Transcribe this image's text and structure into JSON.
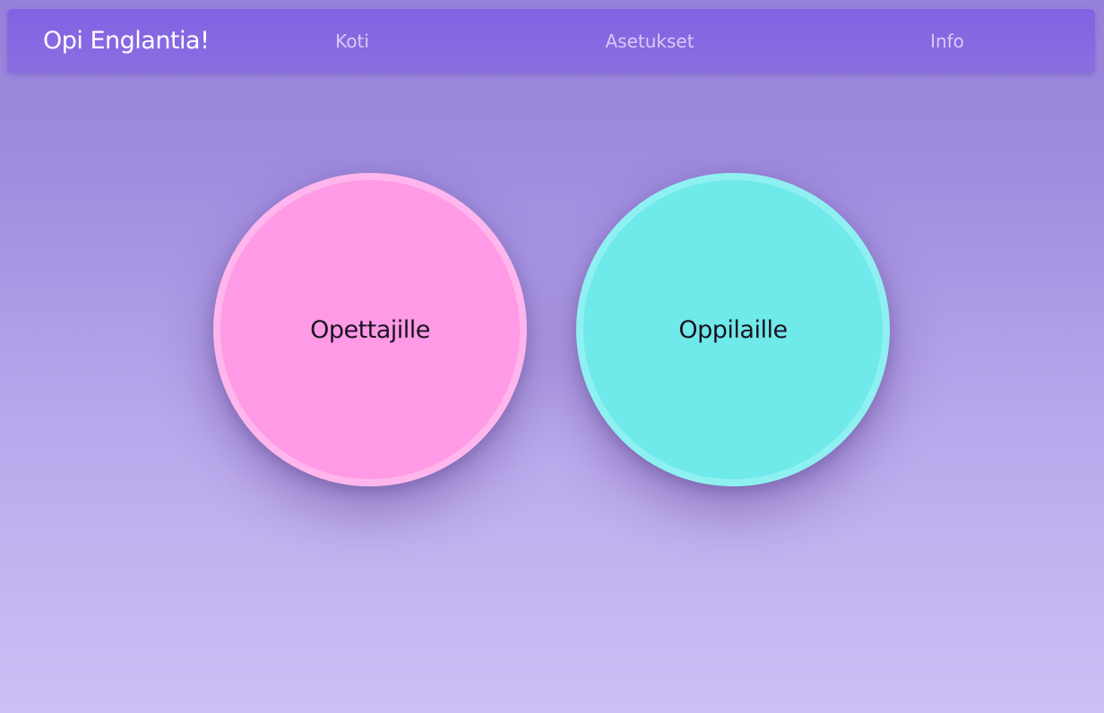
{
  "navbar": {
    "brand": "Opi Englantia!",
    "links": [
      {
        "label": "Koti"
      },
      {
        "label": "Asetukset"
      },
      {
        "label": "Info"
      }
    ]
  },
  "main": {
    "options": [
      {
        "label": "Opettajille",
        "color": "#ff9ae6"
      },
      {
        "label": "Oppilaille",
        "color": "#6fe9e9"
      }
    ]
  },
  "colors": {
    "navbar": "#8262e4",
    "background_top": "#9682d9",
    "background_bottom": "#cdc0f5"
  }
}
